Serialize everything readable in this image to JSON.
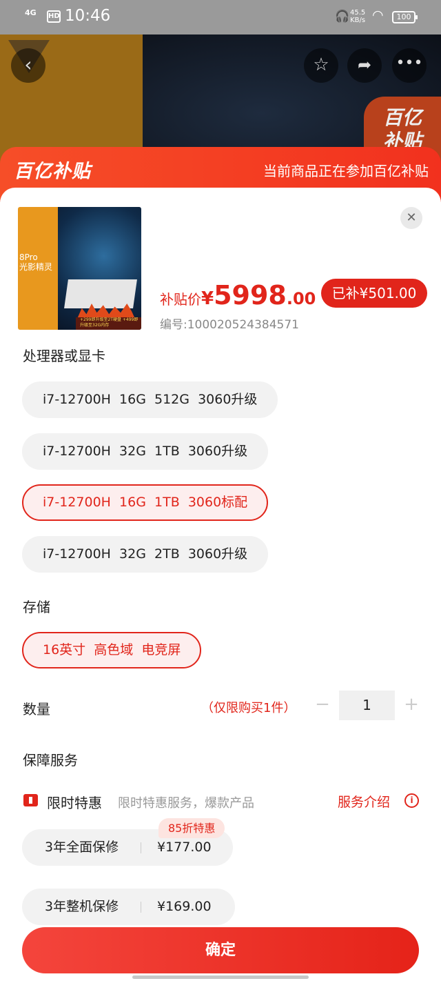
{
  "status_bar": {
    "signal": "4G",
    "hd": "HD",
    "time": "10:46",
    "speed_value": "45.5",
    "speed_unit": "KB/s",
    "battery": "100"
  },
  "hero": {
    "badge_line1": "百亿",
    "badge_line2": "补贴"
  },
  "banner": {
    "logo": "百亿补贴",
    "notice": "当前商品正在参加百亿补贴"
  },
  "product": {
    "thumb_text_1": "8Pro",
    "thumb_text_2": "光影精灵",
    "thumb_footer": "+299即升级至2T硬盘 +499即升级至32G内存",
    "price_label": "补贴价",
    "currency": "¥",
    "price_int": "5998",
    "price_dec": ".00",
    "subsidy": "已补¥501.00",
    "sku": "编号:100020524384571"
  },
  "processor_section": {
    "title": "处理器或显卡",
    "options": [
      {
        "label": "i7-12700H  16G  512G  3060升级",
        "selected": false
      },
      {
        "label": "i7-12700H  32G  1TB  3060升级",
        "selected": false
      },
      {
        "label": "i7-12700H  16G  1TB  3060标配",
        "selected": true
      },
      {
        "label": "i7-12700H  32G  2TB  3060升级",
        "selected": false
      }
    ]
  },
  "storage_section": {
    "title": "存储",
    "options": [
      {
        "label": "16英寸  高色域  电竞屏",
        "selected": true
      }
    ]
  },
  "quantity": {
    "label": "数量",
    "note": "（仅限购买1件）",
    "minus": "−",
    "value": "1",
    "plus": "+"
  },
  "service": {
    "title": "保障服务",
    "promo_title": "限时特惠",
    "promo_desc": "限时特惠服务，爆款产品",
    "intro_link": "服务介绍",
    "discount_badge": "85折特惠",
    "items": [
      {
        "name": "3年全面保修",
        "price": "¥177.00"
      },
      {
        "name": "3年整机保修",
        "price": "¥169.00"
      }
    ]
  },
  "confirm_label": "确定",
  "colors": {
    "accent": "#e1251b",
    "chip_bg": "#f2f2f2",
    "selected_bg": "#fdeeee"
  },
  "icons": [
    "back-icon",
    "star-icon",
    "share-icon",
    "more-icon",
    "close-icon",
    "info-icon",
    "promo-icon"
  ]
}
